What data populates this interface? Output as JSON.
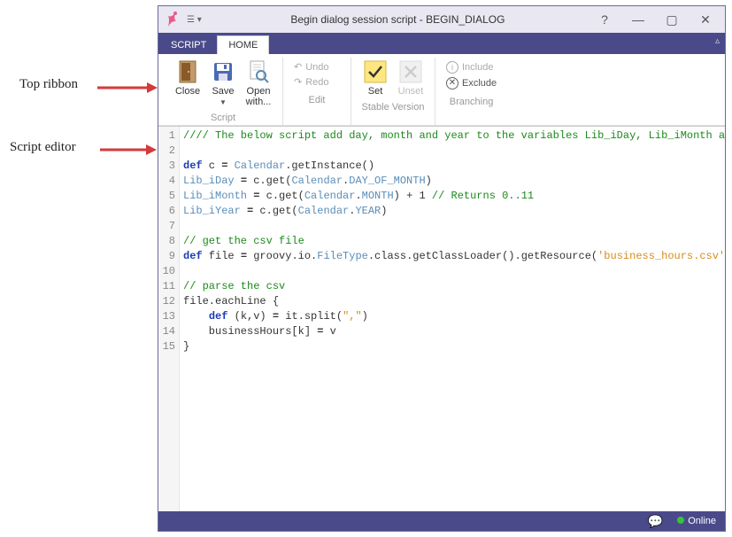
{
  "annotations": {
    "top_ribbon": "Top ribbon",
    "script_editor": "Script editor"
  },
  "window": {
    "title": "Begin dialog session script - BEGIN_DIALOG",
    "help": "?",
    "minimize": "—",
    "maximize": "▢",
    "close": "✕"
  },
  "tabs": {
    "script": "SCRIPT",
    "home": "HOME"
  },
  "ribbon": {
    "script_group": "Script",
    "edit_group": "Edit",
    "stable_group": "Stable Version",
    "branching_group": "Branching",
    "close": "Close",
    "save": "Save",
    "open_with": "Open\nwith...",
    "undo": "Undo",
    "redo": "Redo",
    "set": "Set",
    "unset": "Unset",
    "include": "Include",
    "exclude": "Exclude"
  },
  "code": {
    "lines": [
      {
        "n": 1,
        "segs": [
          {
            "t": "//// The below script add day, month and year to the variables Lib_iDay, Lib_iMonth and Lib_iYear and can be used for date scripting etc.",
            "c": "c-comment"
          }
        ]
      },
      {
        "n": 2,
        "segs": []
      },
      {
        "n": 3,
        "segs": [
          {
            "t": "def",
            "c": "c-kw"
          },
          {
            "t": " c ",
            "c": ""
          },
          {
            "t": "=",
            "c": "c-assign"
          },
          {
            "t": " ",
            "c": ""
          },
          {
            "t": "Calendar",
            "c": "c-type"
          },
          {
            "t": ".getInstance()",
            "c": ""
          }
        ]
      },
      {
        "n": 4,
        "segs": [
          {
            "t": "Lib_iDay",
            "c": "c-var"
          },
          {
            "t": " ",
            "c": ""
          },
          {
            "t": "=",
            "c": "c-assign"
          },
          {
            "t": " c.get(",
            "c": ""
          },
          {
            "t": "Calendar",
            "c": "c-type"
          },
          {
            "t": ".",
            "c": ""
          },
          {
            "t": "DAY_OF_MONTH",
            "c": "c-var"
          },
          {
            "t": ")",
            "c": ""
          }
        ]
      },
      {
        "n": 5,
        "segs": [
          {
            "t": "Lib_iMonth",
            "c": "c-var"
          },
          {
            "t": " ",
            "c": ""
          },
          {
            "t": "=",
            "c": "c-assign"
          },
          {
            "t": " c.get(",
            "c": ""
          },
          {
            "t": "Calendar",
            "c": "c-type"
          },
          {
            "t": ".",
            "c": ""
          },
          {
            "t": "MONTH",
            "c": "c-var"
          },
          {
            "t": ") + 1 ",
            "c": ""
          },
          {
            "t": "// Returns 0..11",
            "c": "c-comment"
          }
        ]
      },
      {
        "n": 6,
        "segs": [
          {
            "t": "Lib_iYear",
            "c": "c-var"
          },
          {
            "t": " ",
            "c": ""
          },
          {
            "t": "=",
            "c": "c-assign"
          },
          {
            "t": " c.get(",
            "c": ""
          },
          {
            "t": "Calendar",
            "c": "c-type"
          },
          {
            "t": ".",
            "c": ""
          },
          {
            "t": "YEAR",
            "c": "c-var"
          },
          {
            "t": ")",
            "c": ""
          }
        ]
      },
      {
        "n": 7,
        "segs": []
      },
      {
        "n": 8,
        "segs": [
          {
            "t": "// get the csv file",
            "c": "c-comment"
          }
        ]
      },
      {
        "n": 9,
        "segs": [
          {
            "t": "def",
            "c": "c-kw"
          },
          {
            "t": " file ",
            "c": ""
          },
          {
            "t": "=",
            "c": "c-assign"
          },
          {
            "t": " groovy.io.",
            "c": ""
          },
          {
            "t": "FileType",
            "c": "c-type"
          },
          {
            "t": ".class.getClassLoader().getResource(",
            "c": ""
          },
          {
            "t": "'business_hours.csv'",
            "c": "c-str"
          },
          {
            "t": ")",
            "c": ""
          }
        ]
      },
      {
        "n": 10,
        "segs": []
      },
      {
        "n": 11,
        "segs": [
          {
            "t": "// parse the csv",
            "c": "c-comment"
          }
        ]
      },
      {
        "n": 12,
        "segs": [
          {
            "t": "file.eachLine {",
            "c": ""
          }
        ]
      },
      {
        "n": 13,
        "segs": [
          {
            "t": "    ",
            "c": ""
          },
          {
            "t": "def",
            "c": "c-kw"
          },
          {
            "t": " (k,v) ",
            "c": ""
          },
          {
            "t": "=",
            "c": "c-assign"
          },
          {
            "t": " it.split(",
            "c": ""
          },
          {
            "t": "\",\"",
            "c": "c-str"
          },
          {
            "t": ")",
            "c": ""
          }
        ]
      },
      {
        "n": 14,
        "segs": [
          {
            "t": "    businessHours[k] ",
            "c": ""
          },
          {
            "t": "=",
            "c": "c-assign"
          },
          {
            "t": " v",
            "c": ""
          }
        ]
      },
      {
        "n": 15,
        "segs": [
          {
            "t": "}",
            "c": ""
          }
        ]
      }
    ]
  },
  "status": {
    "online": "Online"
  }
}
